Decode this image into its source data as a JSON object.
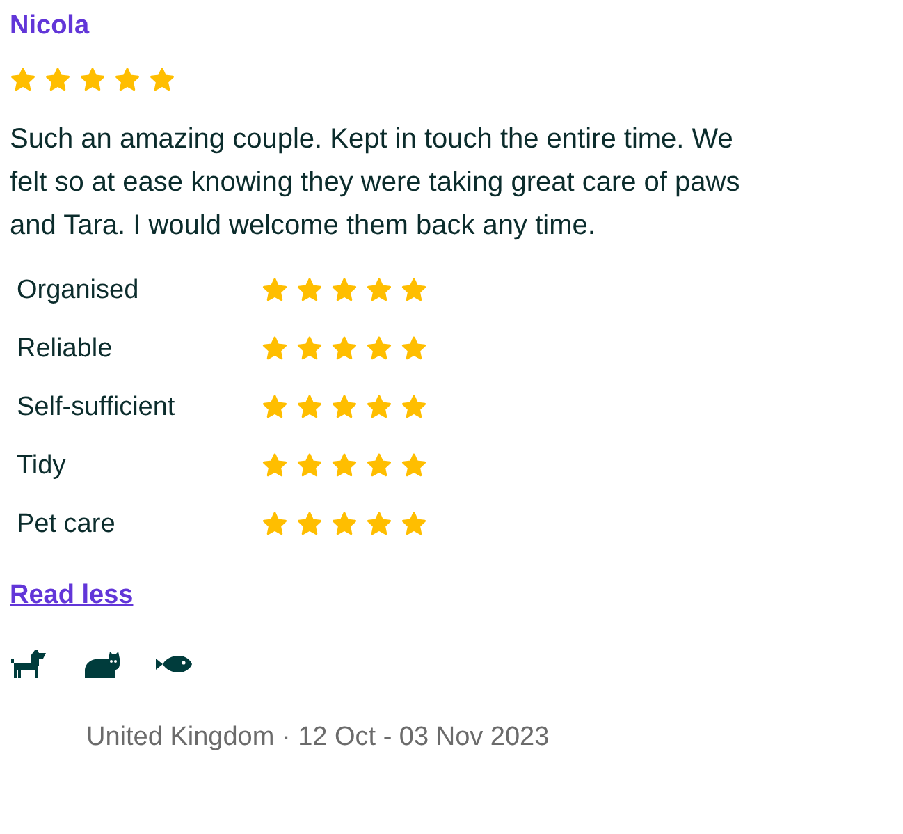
{
  "reviewer": {
    "name": "Nicola",
    "stars": 5
  },
  "review": "Such an amazing couple. Kept in touch the entire time. We felt so at ease knowing they were taking great care of paws and Tara. I would welcome them back any time.",
  "ratings": [
    {
      "label": "Organised",
      "stars": 5
    },
    {
      "label": "Reliable",
      "stars": 5
    },
    {
      "label": "Self-sufficient",
      "stars": 5
    },
    {
      "label": "Tidy",
      "stars": 5
    },
    {
      "label": "Pet care",
      "stars": 5
    }
  ],
  "toggle_link": "Read less",
  "pets": [
    {
      "kind": "dog"
    },
    {
      "kind": "cat"
    },
    {
      "kind": "fish"
    }
  ],
  "footer": "United Kingdom · 12 Oct - 03 Nov 2023"
}
